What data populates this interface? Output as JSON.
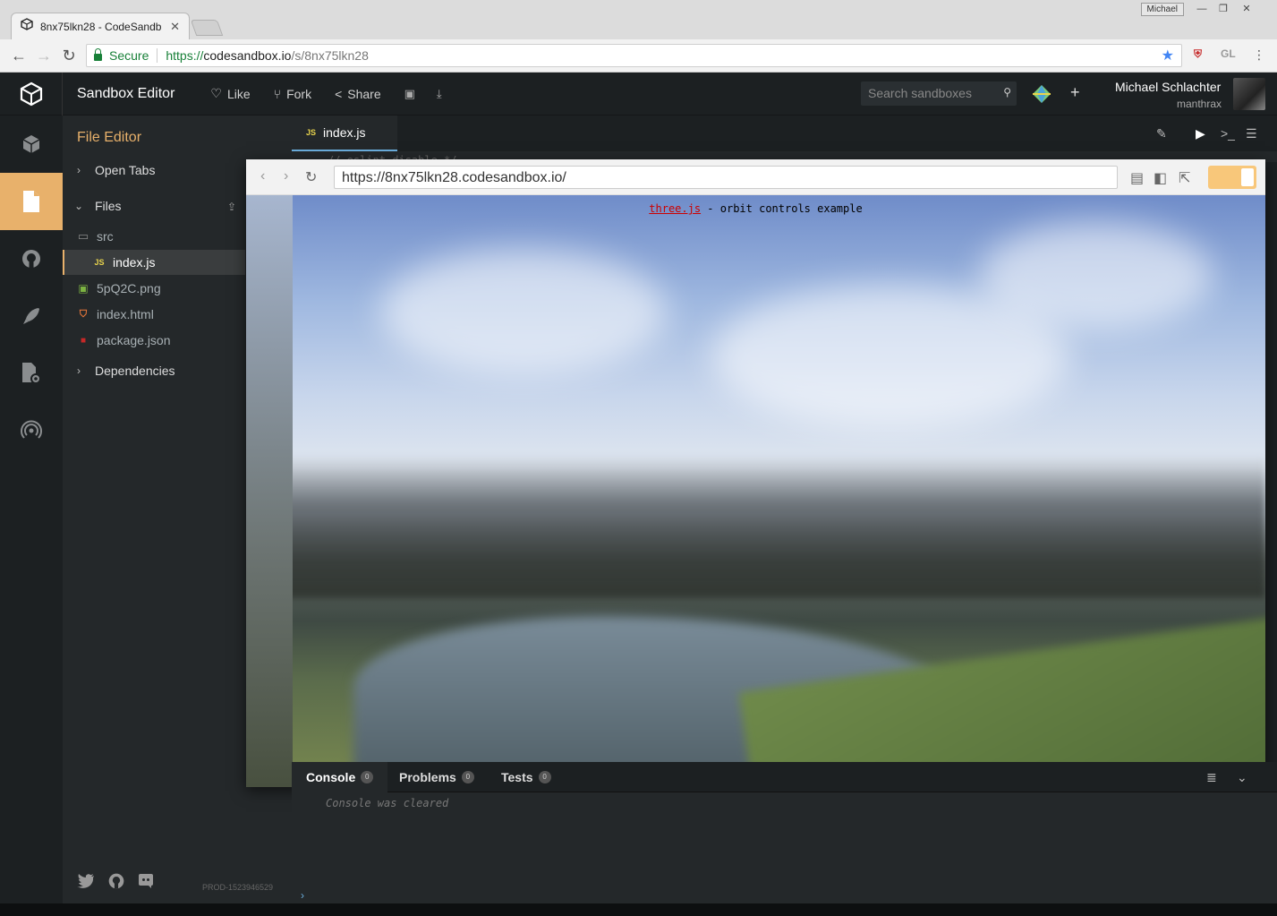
{
  "browser": {
    "tab_title": "8nx75lkn28 - CodeSandb",
    "profile_name": "Michael",
    "secure_label": "Secure",
    "url_scheme": "https://",
    "url_host": "codesandbox.io",
    "url_path": "/s/8nx75lkn28",
    "ext_label": "GL"
  },
  "header": {
    "title": "Sandbox Editor",
    "like_label": "Like",
    "fork_label": "Fork",
    "share_label": "Share",
    "search_placeholder": "Search sandboxes",
    "user_name": "Michael Schlachter",
    "user_handle": "manthrax"
  },
  "sidebar": {
    "title": "File Editor",
    "open_tabs_label": "Open Tabs",
    "files_label": "Files",
    "dependencies_label": "Dependencies",
    "files": [
      {
        "name": "src",
        "type": "folder"
      },
      {
        "name": "index.js",
        "type": "js"
      },
      {
        "name": "5pQ2C.png",
        "type": "image"
      },
      {
        "name": "index.html",
        "type": "html"
      },
      {
        "name": "package.json",
        "type": "json"
      }
    ],
    "build_id": "PROD-1523946529"
  },
  "editor": {
    "active_tab": "index.js",
    "peek_line": "// eslint-disable */"
  },
  "preview": {
    "url": "https://8nx75lkn28.codesandbox.io/",
    "scene_link": "three.js",
    "scene_caption": " - orbit controls example"
  },
  "console": {
    "tabs": [
      {
        "label": "Console",
        "count": "0"
      },
      {
        "label": "Problems",
        "count": "0"
      },
      {
        "label": "Tests",
        "count": "0"
      }
    ],
    "message": "Console was cleared"
  },
  "colors": {
    "accent": "#e8b16b",
    "background": "#1c2022",
    "panel": "#24282a",
    "link_blue": "#6caedd"
  }
}
